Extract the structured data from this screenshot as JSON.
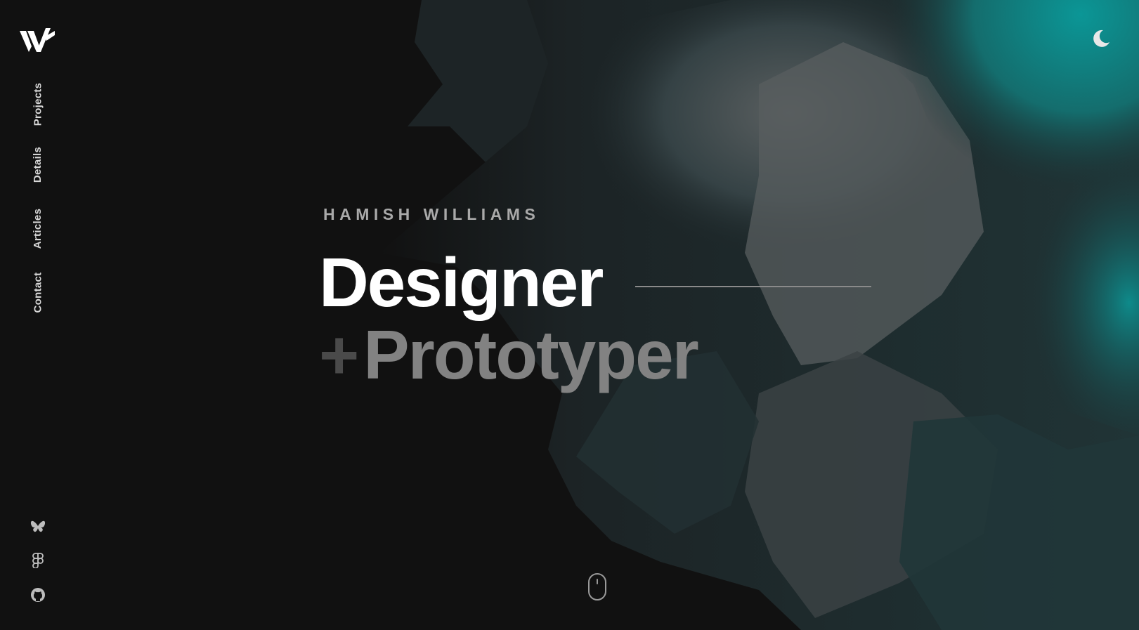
{
  "brand": {
    "logo_icon": "w-logo-icon"
  },
  "nav": {
    "items": [
      {
        "label": "Projects"
      },
      {
        "label": "Details"
      },
      {
        "label": "Articles"
      },
      {
        "label": "Contact"
      }
    ]
  },
  "theme_toggle": {
    "icon": "moon-icon"
  },
  "social": [
    {
      "icon": "bluesky-icon"
    },
    {
      "icon": "figma-icon"
    },
    {
      "icon": "github-icon"
    }
  ],
  "hero": {
    "name": "Hamish Williams",
    "title": "Designer",
    "plus": "+",
    "subtitle": "Prototyper"
  },
  "scroll_indicator": {
    "icon": "mouse-icon"
  },
  "colors": {
    "background": "#111111",
    "accent_teal": "#0a8c8c",
    "text_primary": "#ffffff",
    "text_muted": "#828282"
  }
}
